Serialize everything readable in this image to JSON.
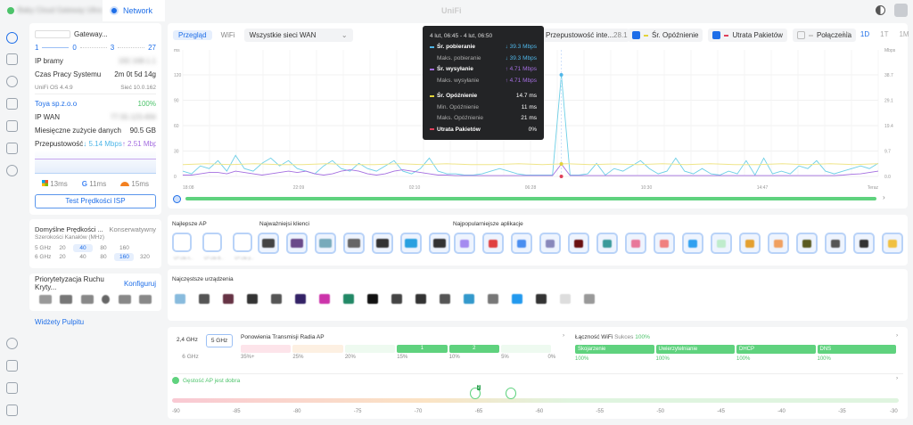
{
  "topbar": {
    "device_name": "Baby Cloud Gateway Ultra",
    "app_tab": "Network",
    "center_title": "UniFi"
  },
  "sidebar": {
    "items": [
      "dashboard",
      "topology",
      "unifi-devices",
      "client-devices",
      "ports",
      "insights",
      "security",
      "settings",
      "system-log",
      "alerts",
      "admins"
    ]
  },
  "gateway": {
    "name": "Gateway...",
    "counts": {
      "wan": "1",
      "switches": "0",
      "aps": "3",
      "clients": "27"
    },
    "ip_label": "IP bramy",
    "ip_value": "192.168.1.1",
    "uptime_label": "Czas Pracy Systemu",
    "uptime_value": "2m 0t 5d 14g",
    "os_version": "UniFi OS 4.4.9",
    "network_version": "Sieć 10.0.162",
    "isp_name": "Toya sp.z.o.o",
    "isp_uptime": "100%",
    "wan_ip_label": "IP WAN",
    "wan_ip_value": "77.55.123.456",
    "data_usage_label": "Miesięczne zużycie danych",
    "data_usage_value": "90.5 GB",
    "throughput_label": "Przepustowość",
    "download": "↓ 5.14 Mbps",
    "upload": "↑ 2.51 Mbps",
    "latency": [
      {
        "service": "Microsoft",
        "value": "13ms"
      },
      {
        "service": "Google",
        "value": "11ms"
      },
      {
        "service": "Cloudflare",
        "value": "15ms"
      }
    ],
    "speed_test_button": "Test Prędkości ISP"
  },
  "radio": {
    "title": "Domyślne Prędkości ...",
    "mode": "Konserwatywny",
    "subtitle": "Szerokości Kanałów (MHz)",
    "bands": [
      {
        "band": "5 GHz",
        "widths": [
          "20",
          "40",
          "80",
          "160"
        ],
        "selected": "40"
      },
      {
        "band": "6 GHz",
        "widths": [
          "20",
          "40",
          "80",
          "160",
          "320"
        ],
        "selected": "160"
      }
    ]
  },
  "priority": {
    "title": "Priorytetyzacja Ruchu Kryty...",
    "configure": "Konfiguruj"
  },
  "dashboard_widgets_link": "Widżety Pulpitu",
  "chart_toolbar": {
    "tabs": [
      "Przegląd",
      "WiFi"
    ],
    "active_tab": "Przegląd",
    "wan_select": "Wszystkie sieci WAN",
    "bandwidth_select": "Przepustowość inte...",
    "bandwidth_total": "28.1 GB",
    "toggles": [
      {
        "label": "Śr. Opóźnienie",
        "checked": true,
        "color": "#e3d43a"
      },
      {
        "label": "Utrata Pakietów",
        "checked": true,
        "color": "#e0405a"
      },
      {
        "label": "Połączenia",
        "checked": false,
        "color": "#cccccc"
      }
    ],
    "ranges": [
      "1h",
      "1D",
      "1T",
      "1M"
    ],
    "active_range": "1D"
  },
  "tooltip": {
    "range": "4 lut, 06:45 - 4 lut, 06:50",
    "rows": [
      {
        "label": "Śr. pobieranie",
        "value": "↓ 39.3 Mbps",
        "bold": true,
        "color": "#4fb6e8"
      },
      {
        "label": "Maks. pobieranie",
        "value": "↓ 39.3 Mbps",
        "color": "#4fb6e8"
      },
      {
        "label": "Śr. wysyłanie",
        "value": "↑ 4.71 Mbps",
        "bold": true,
        "color": "#a46ee0"
      },
      {
        "label": "Maks. wysyłanie",
        "value": "↑ 4.71 Mbps",
        "color": "#a46ee0"
      },
      {
        "label": "Śr. Opóźnienie",
        "value": "14.7 ms",
        "bold": true,
        "color": "#e3d43a"
      },
      {
        "label": "Min. Opóźnienie",
        "value": "11 ms"
      },
      {
        "label": "Maks. Opóźnienie",
        "value": "21 ms"
      },
      {
        "label": "Utrata Pakietów",
        "value": "0%",
        "bold": true,
        "color": "#e0405a"
      }
    ]
  },
  "chart_data": {
    "type": "line",
    "left_unit": "ms",
    "right_unit": "Mbps",
    "left_ticks": [
      "0",
      "30",
      "60",
      "90",
      "120"
    ],
    "right_ticks": [
      "0.0",
      "9.7",
      "19.4",
      "29.1",
      "38.7"
    ],
    "x_ticks": [
      "18:08",
      "22:09",
      "02:10",
      "06:28",
      "10:30",
      "14:47",
      "Teraz"
    ],
    "ylim_ms": [
      0,
      148
    ],
    "ylim_mbps": [
      0,
      47.7
    ],
    "series": [
      {
        "key": "download",
        "unit": "Mbps",
        "color": "#6dcfe6",
        "values": [
          2,
          1,
          4,
          3,
          6,
          2,
          8,
          3,
          2,
          5,
          7,
          4,
          6,
          3,
          2,
          1,
          4,
          6,
          3,
          2,
          5,
          3,
          2,
          4,
          6,
          2,
          1,
          3,
          7,
          2,
          1,
          1,
          0.5,
          0.5,
          1,
          2,
          3,
          2,
          1,
          0.5,
          0.5,
          0.5,
          0.5,
          38.7,
          0.5,
          0.5,
          1,
          5,
          0.5,
          3,
          2,
          4,
          6,
          3,
          1,
          2,
          7,
          2,
          1,
          3,
          1,
          0.5,
          2,
          1,
          6,
          0.5,
          7,
          1,
          2,
          1,
          4,
          3,
          6,
          2,
          1,
          2,
          3,
          4,
          3,
          5
        ]
      },
      {
        "key": "upload",
        "unit": "Mbps",
        "color": "#a46ee0",
        "values": [
          0.5,
          0.5,
          1,
          1.5,
          1.5,
          1,
          2,
          1.5,
          1,
          0.5,
          1,
          1.5,
          2,
          1.5,
          2,
          1,
          0.5,
          1,
          2,
          2.5,
          2,
          1,
          0.5,
          1,
          2,
          2.5,
          2,
          1.5,
          1,
          0.5,
          0.5,
          0.3,
          0.3,
          0.3,
          0.3,
          0.3,
          0.3,
          0.3,
          0.3,
          0.3,
          0.3,
          0.3,
          0.3,
          4.71,
          0.3,
          0.3,
          0.3,
          0.3,
          0.3,
          0.3,
          0.3,
          0.3,
          0.3,
          0.3,
          0.3,
          0.3,
          0.3,
          0.3,
          0.3,
          0.3,
          0.3,
          0.3,
          0.3,
          0.3,
          0.3,
          0.3,
          0.3,
          0.3,
          0.3,
          0.3,
          0.3,
          0.3,
          0.3,
          0.3,
          0.3,
          0.5,
          0.8,
          1,
          1.5,
          2
        ]
      },
      {
        "key": "latency",
        "unit": "ms",
        "color": "#efe58a",
        "values": [
          14,
          15,
          14,
          15,
          14,
          14,
          15,
          14,
          14,
          15,
          14,
          15,
          14,
          14,
          15,
          14,
          15,
          14,
          14.7,
          14,
          15,
          14,
          15,
          14,
          14,
          15,
          14,
          15,
          14,
          15
        ]
      },
      {
        "key": "packet_loss",
        "unit": "%",
        "color": "#e0405a",
        "values": [
          0
        ]
      }
    ],
    "highlight": {
      "x": "06:45",
      "download": 38.7,
      "latency": 14.7,
      "packet_loss": 0
    }
  },
  "widgets": {
    "best_ap": "Najlepsze AP",
    "ap_items": [
      "U7 Lite A...",
      "U7 Lite B...",
      "U7 Lite p..."
    ],
    "top_clients": "Najważniejsi klienci",
    "popular_apps": "Najpopularniejsze aplikacje",
    "frequent_devices": "Najczęstsze urządzenia"
  },
  "retrans": {
    "bands": [
      "2,4 GHz",
      "5 GHz",
      "6 GHz"
    ],
    "active_band": "5 GHz",
    "title": "Ponowienia Transmisji Radia AP",
    "buckets": [
      {
        "label": "35%+",
        "count": ""
      },
      {
        "label": "25%",
        "count": ""
      },
      {
        "label": "20%",
        "count": ""
      },
      {
        "label": "15%",
        "count": "1"
      },
      {
        "label": "10%",
        "count": "2"
      },
      {
        "label": "5%",
        "count": ""
      },
      {
        "label": "0%",
        "count": ""
      }
    ]
  },
  "wifi_conn": {
    "title": "Łączność WiFi",
    "success_label": "Sukces",
    "success_value": "100%",
    "steps": [
      {
        "label": "Skojarzenie",
        "value": "100%"
      },
      {
        "label": "Uwierzytelnianie",
        "value": "100%"
      },
      {
        "label": "DHCP",
        "value": "100%"
      },
      {
        "label": "DNS",
        "value": "100%"
      }
    ]
  },
  "density": {
    "status": "Gęstość AP jest dobra",
    "ticks": [
      "-90",
      "-85",
      "-80",
      "-75",
      "-70",
      "-65",
      "-60",
      "-55",
      "-50",
      "-45",
      "-40",
      "-35",
      "-30"
    ],
    "markers": [
      {
        "dbm": -65,
        "count": "2"
      },
      {
        "dbm": -62,
        "count": ""
      }
    ]
  }
}
